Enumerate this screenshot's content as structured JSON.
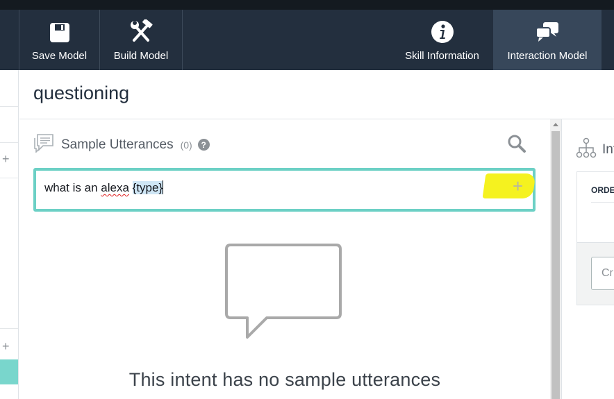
{
  "toolbar": {
    "save_label": "Save Model",
    "build_label": "Build Model",
    "skill_info_label": "Skill Information",
    "interaction_model_label": "Interaction Model"
  },
  "page": {
    "title": "questioning"
  },
  "sample_utterances": {
    "title": "Sample Utterances",
    "count": "(0)",
    "help": "?",
    "input_text": "what is an ",
    "input_misspelled": "alexa",
    "input_slot": "{type}",
    "add_symbol": "+",
    "empty_message": "This intent has no sample utterances"
  },
  "right_panel": {
    "heading": "Int",
    "column_header": "ORDE",
    "input_placeholder": "Cr"
  },
  "left_strip": {
    "plus_symbol": "+"
  },
  "icons": {
    "save": "save-icon",
    "build": "hammer-wrench-icon",
    "info": "info-icon",
    "chat": "chat-bubbles-icon",
    "utterances": "speech-bubble-icon",
    "search": "search-icon",
    "tree": "hierarchy-icon"
  },
  "colors": {
    "toolbar_bg": "#232f3e",
    "active_tab_bg": "#37475a",
    "input_border": "#6cd0c5",
    "highlight": "#f5f21f"
  }
}
